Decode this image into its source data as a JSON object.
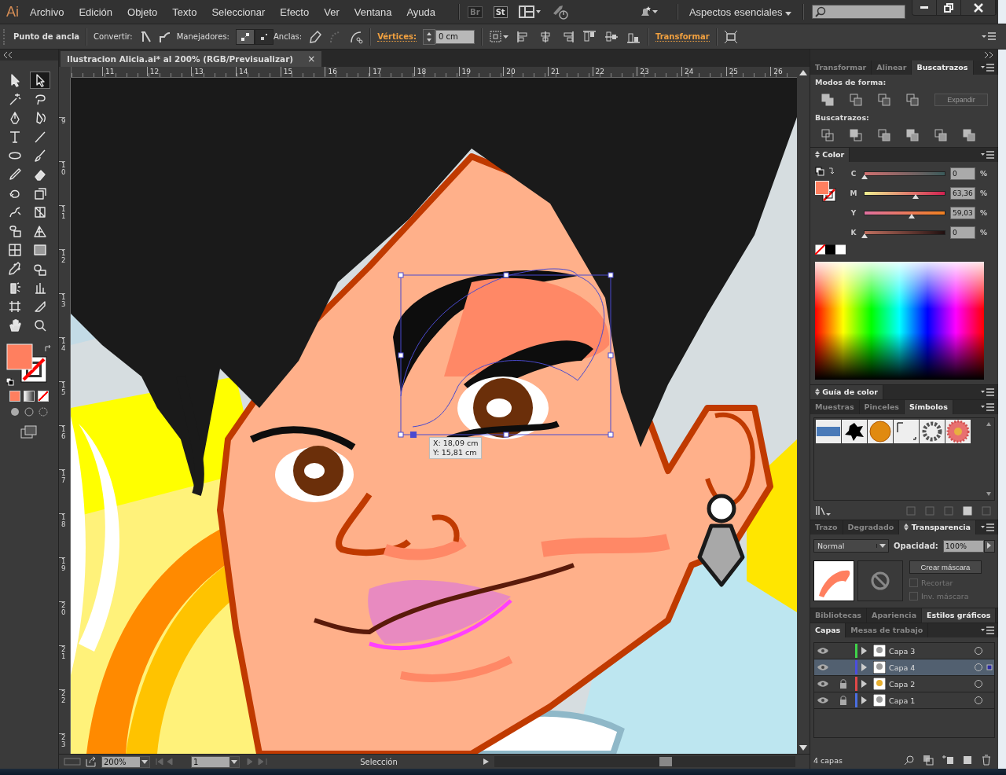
{
  "app": {
    "logo": "Ai",
    "menu": [
      "Archivo",
      "Edición",
      "Objeto",
      "Texto",
      "Seleccionar",
      "Efecto",
      "Ver",
      "Ventana",
      "Ayuda"
    ],
    "bridge": "Br",
    "stock": "St",
    "workspace": "Aspectos esenciales"
  },
  "control_bar": {
    "title": "Punto de ancla",
    "convert": "Convertir:",
    "handles": "Manejadores:",
    "anchors": "Anclas:",
    "corners": "Vértices:",
    "corner_value": "0 cm",
    "transform": "Transformar"
  },
  "document_tab": {
    "title": "Ilustracion Alicia.ai* al 200% (RGB/Previsualizar)",
    "close": "×"
  },
  "rulers": {
    "horizontal": [
      "11",
      "12",
      "13",
      "14",
      "15",
      "16",
      "17",
      "18",
      "19",
      "20",
      "21",
      "22",
      "23",
      "24",
      "25",
      "26"
    ],
    "vertical": [
      "9",
      "10",
      "11",
      "12",
      "13",
      "14",
      "15",
      "16",
      "17",
      "18",
      "19",
      "20",
      "21",
      "22",
      "23"
    ]
  },
  "tools": [
    {
      "selected": false
    },
    {
      "selected": true
    },
    {
      "selected": false
    },
    {
      "selected": false
    },
    {
      "selected": false
    },
    {
      "selected": false
    },
    {
      "selected": false
    },
    {
      "selected": false
    },
    {
      "selected": false
    },
    {
      "selected": false
    },
    {
      "selected": false
    },
    {
      "selected": false
    },
    {
      "selected": false
    },
    {
      "selected": false
    },
    {
      "selected": false
    },
    {
      "selected": false
    },
    {
      "selected": false
    },
    {
      "selected": false
    },
    {
      "selected": false
    },
    {
      "selected": false
    },
    {
      "selected": false
    },
    {
      "selected": false
    },
    {
      "selected": false
    },
    {
      "selected": false
    },
    {
      "selected": false
    },
    {
      "selected": false
    },
    {
      "selected": false
    },
    {
      "selected": false
    }
  ],
  "canvas": {
    "tooltip": [
      "X: 18,09 cm",
      "Y: 15,81 cm"
    ]
  },
  "status_bar": {
    "zoom": "200%",
    "page": "1",
    "tool": "Selección"
  },
  "pathfinder": {
    "tabs": [
      {
        "label": "Transformar",
        "selected": false
      },
      {
        "label": "Alinear",
        "selected": false
      },
      {
        "label": "Buscatrazos",
        "selected": true
      }
    ],
    "shape_modes": "Modos de forma:",
    "expand": "Expandir",
    "expand_disabled": true,
    "pathfinders": "Buscatrazos:"
  },
  "color": {
    "title": "Color",
    "sliders": [
      {
        "label": "C",
        "level": 0,
        "value": "0",
        "unit": "%"
      },
      {
        "label": "M",
        "level": 0.6336,
        "value": "63,36",
        "unit": "%"
      },
      {
        "label": "Y",
        "level": 0.5903,
        "value": "59,03",
        "unit": "%"
      },
      {
        "label": "K",
        "level": 0,
        "value": "0",
        "unit": "%"
      }
    ]
  },
  "color_guide": {
    "title": "Guía de color"
  },
  "symbols": {
    "tabs": [
      {
        "label": "Muestras",
        "selected": false
      },
      {
        "label": "Pinceles",
        "selected": false
      },
      {
        "label": "Símbolos",
        "selected": true
      }
    ]
  },
  "transparency": {
    "tabs": [
      {
        "label": "Trazo",
        "selected": false
      },
      {
        "label": "Degradado",
        "selected": false
      },
      {
        "label": "Transparencia",
        "selected": true
      }
    ],
    "blend_mode": "Normal",
    "opacity_label": "Opacidad:",
    "opacity": "100%",
    "make_mask": "Crear máscara",
    "clip": {
      "label": "Recortar",
      "checked": false
    },
    "invert": {
      "label": "Inv. máscara",
      "checked": false
    }
  },
  "styles": {
    "tabs": [
      {
        "label": "Bibliotecas",
        "selected": false
      },
      {
        "label": "Apariencia",
        "selected": false
      },
      {
        "label": "Estilos gráficos",
        "selected": true
      }
    ]
  },
  "layers": {
    "tabs": [
      {
        "label": "Capas",
        "selected": true
      },
      {
        "label": "Mesas de trabajo",
        "selected": false
      }
    ],
    "items": [
      {
        "name": "Capa 3",
        "visible": true,
        "locked": false,
        "color": "#3fd34a",
        "selected": false
      },
      {
        "name": "Capa 4",
        "visible": true,
        "locked": false,
        "color": "#4a4ee0",
        "selected": true
      },
      {
        "name": "Capa 2",
        "visible": true,
        "locked": true,
        "color": "#e04848",
        "selected": false
      },
      {
        "name": "Capa 1",
        "visible": true,
        "locked": true,
        "color": "#4a6ee0",
        "selected": false
      }
    ],
    "count": "4 capas"
  }
}
